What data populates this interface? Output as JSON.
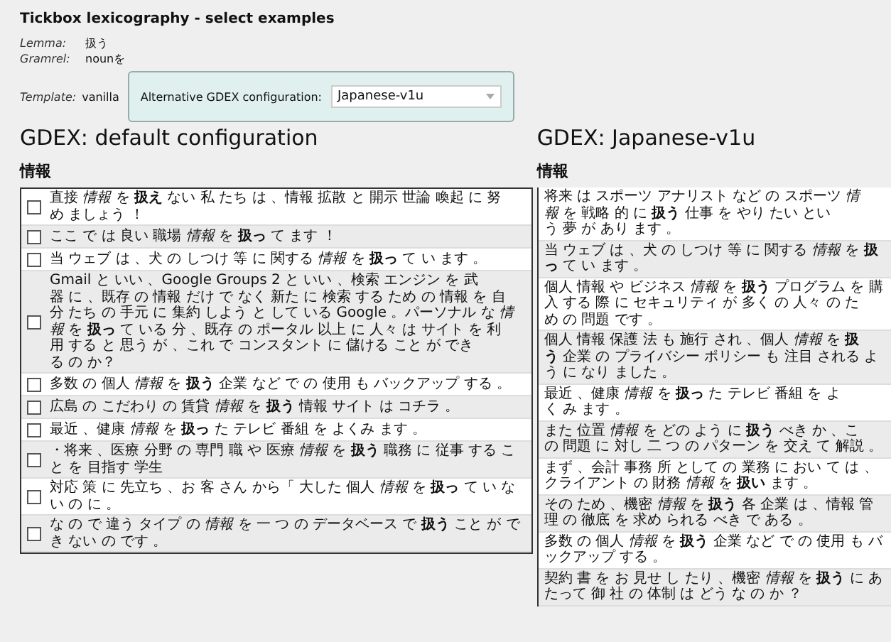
{
  "title": "Tickbox lexicography - select examples",
  "meta": [
    {
      "label": "Lemma:",
      "value": "扱う"
    },
    {
      "label": "Gramrel:",
      "value": "nounを"
    }
  ],
  "template": {
    "label": "Template:",
    "value": "vanilla"
  },
  "config": {
    "label": "Alternative GDEX configuration:",
    "value": "Japanese-v1u"
  },
  "left": {
    "heading": "GDEX: default configuration",
    "word": "情報",
    "rows": [
      {
        "text": "直接 *情報* を **扱え** ない 私 たち は 、情報 拡散 と 開示 世論 喚起 に 努め ましょう ！",
        "checked": false
      },
      {
        "text": "ここ で は 良い 職場 *情報* を **扱っ** て ます ！",
        "checked": false
      },
      {
        "text": "当 ウェブ は 、犬 の しつけ 等 に 関する *情報* を **扱っ** て い ます 。",
        "checked": false
      },
      {
        "text": "Gmail と いい 、Google Groups 2 と いい 、検索 エンジン を 武器 に 、既存 の 情報 だけ で なく 新た に 検索 する ため の 情報 を 自分 たち の 手元 に 集約 しよう と して いる Google 。パーソナル な *情報* を **扱っ** て いる 分 、既存 の ポータル 以上 に 人々 は サイト を 利用 する と 思う が 、これ で コンスタント に 儲ける こと が できる の か？",
        "checked": false
      },
      {
        "text": "多数 の 個人 *情報* を **扱う** 企業 など で の 使用 も バックアップ する 。",
        "checked": false
      },
      {
        "text": "広島 の こだわり の 賃貸 *情報* を **扱う** 情報 サイト は コチラ 。",
        "checked": false
      },
      {
        "text": "最近 、健康 *情報* を **扱っ** た テレビ 番組 を よくみ ます 。",
        "checked": false
      },
      {
        "text": "・将来 、医療 分野 の 専門 職 や 医療 *情報* を **扱う** 職務 に 従事 する こと を 目指す 学生",
        "checked": false
      },
      {
        "text": "対応 策 に 先立ち 、お 客 さん から「 大した 個人 *情報* を **扱っ** て い ない の に 。",
        "checked": false
      },
      {
        "text": "な の で 違う タイプ の *情報* を 一 つ の データベース で **扱う** こと が でき ない の です 。",
        "checked": false
      }
    ]
  },
  "right": {
    "heading": "GDEX: Japanese-v1u",
    "word": "情報",
    "rows": [
      "将来 は スポーツ アナリスト など の スポーツ *情報* を 戦略 的 に **扱う** 仕事 を やり たい という 夢 が あり ます 。",
      "当 ウェブ は 、犬 の しつけ 等 に 関する *情報* を **扱っ** て い ます 。",
      "個人 情報 や ビジネス *情報* を **扱う** プログラム を 購入 する 際 に セキュリティ が 多く の 人々 の ため の 問題 です 。",
      "個人 情報 保護 法 も 施行 され 、個人 *情報* を **扱う** 企業 の プライバシー ポリシー も 注目 される よう に なり ました 。",
      "最近 、健康 *情報* を **扱っ** た テレビ 番組 を よく み ます 。",
      "また 位置 *情報* を どの よう に **扱う** べき か 、この 問題 に 対し 二 つ の パターン を 交え て 解説 。",
      "まず 、会計 事務 所 として の 業務 に おい て は 、クライアント の 財務 *情報* を **扱い** ます 。",
      "その ため 、機密 *情報* を **扱う** 各 企業 は 、情報 管理 の 徹底 を 求め られる べき で ある 。",
      "多数 の 個人 *情報* を **扱う** 企業 など で の 使用 も バックアップ する 。",
      "契約 書 を お 見せ し たり 、機密 *情報* を **扱う** に あたって 御 社 の 体制 は どう な の か ？"
    ]
  }
}
